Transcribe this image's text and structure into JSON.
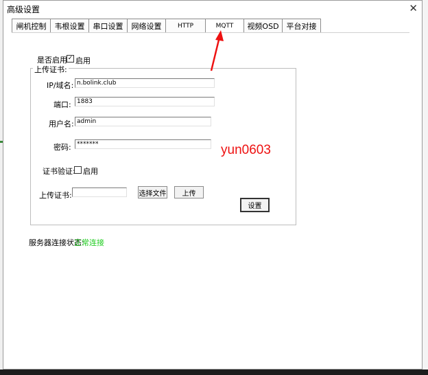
{
  "window": {
    "title": "高级设置"
  },
  "tabs": [
    {
      "label": "闸机控制"
    },
    {
      "label": "韦根设置"
    },
    {
      "label": "串口设置"
    },
    {
      "label": "网络设置"
    },
    {
      "label": "HTTP"
    },
    {
      "label": "MQTT"
    },
    {
      "label": "视频OSD"
    },
    {
      "label": "平台对接"
    }
  ],
  "active_tab": "MQTT",
  "mqtt": {
    "enable_label": "是否启用",
    "enable_checkbox_label": "启用",
    "enabled": true,
    "group_title": "上传证书:",
    "ip_label": "IP/域名:",
    "ip_value": "n.bolink.club",
    "port_label": "端口:",
    "port_value": "1883",
    "username_label": "用户名:",
    "username_value": "admin",
    "password_label": "密码:",
    "password_value": "*******",
    "cert_verify_label": "证书验证:",
    "cert_verify_checkbox_label": "启用",
    "cert_verify_enabled": false,
    "upload_cert_label": "上传证书:",
    "upload_cert_value": "",
    "choose_file_button": "选择文件",
    "upload_button": "上传",
    "settings_button": "设置"
  },
  "status": {
    "label": "服务器连接状态:",
    "value": "正常连接",
    "value_color": "#22cc22"
  },
  "annotation": {
    "watermark_text": "yun0603",
    "color": "#ee1111"
  },
  "icons": {
    "close": "close-icon",
    "arrow": "arrow-annotation-icon"
  }
}
